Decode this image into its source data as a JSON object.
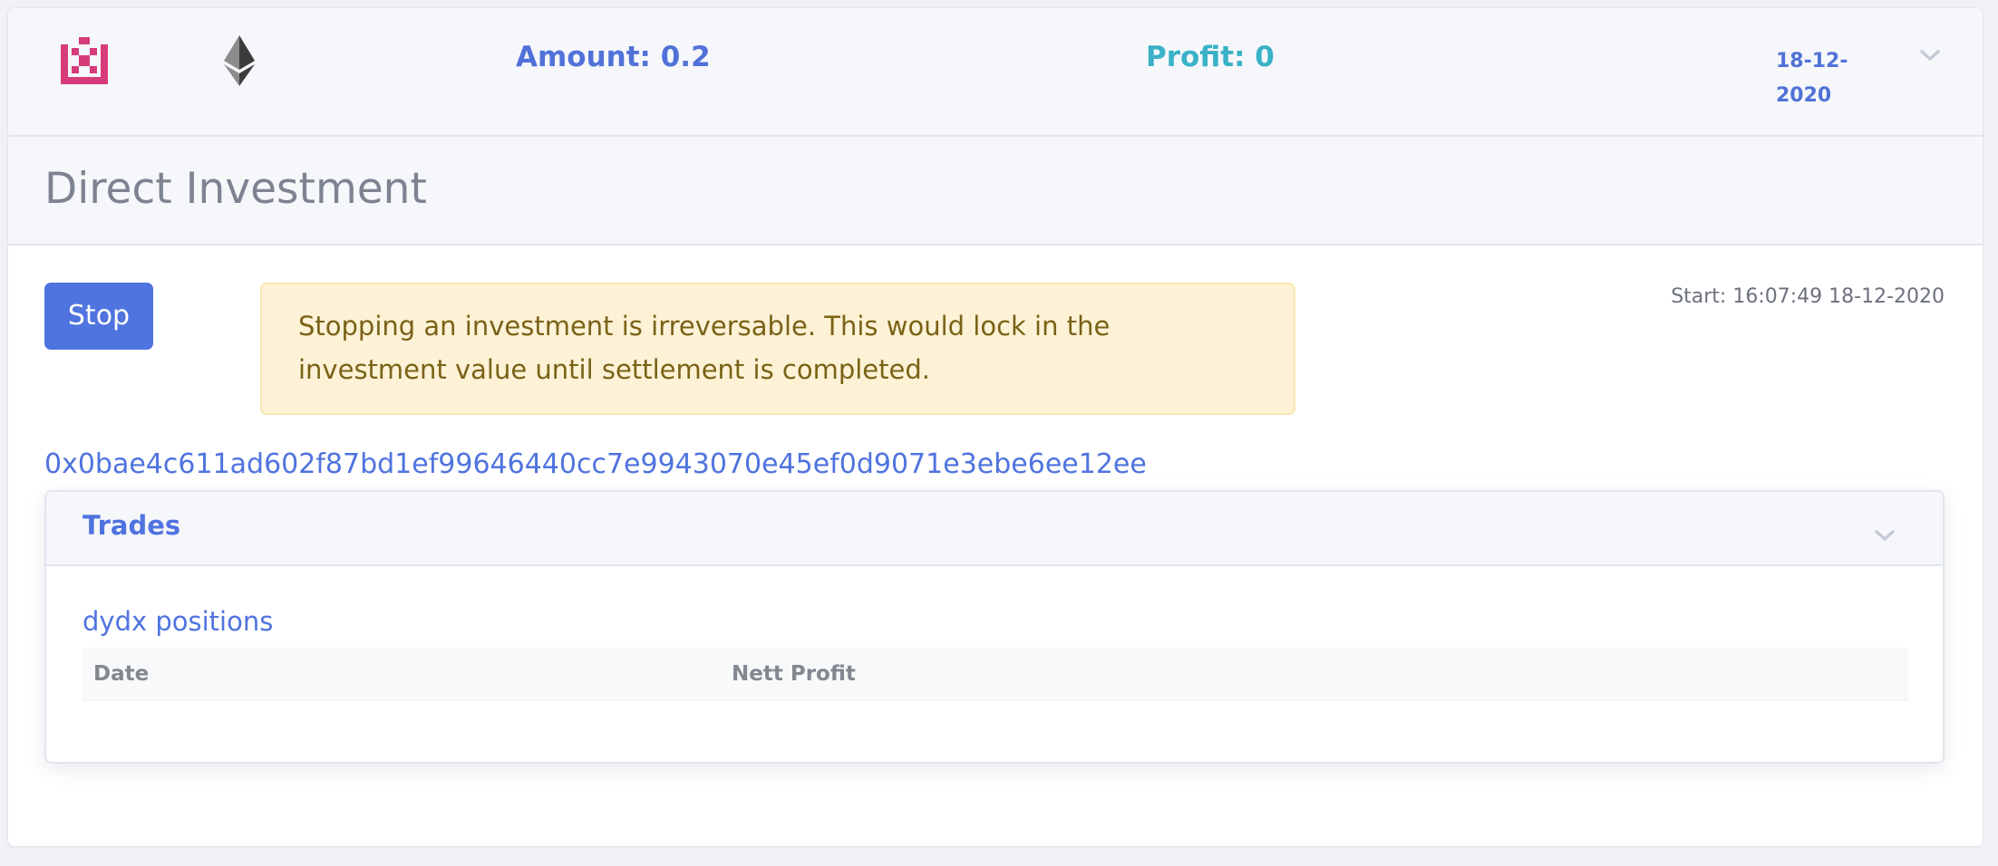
{
  "header": {
    "logo_icon": "pixel-logo-icon",
    "logo_color": "#d63b7a",
    "currency_icon": "ethereum-icon",
    "amount_text": "Amount: 0.2",
    "profit_text": "Profit: 0",
    "date_text": "18-12-2020",
    "expand_icon": "chevron-down-icon"
  },
  "section": {
    "title": "Direct Investment"
  },
  "actions": {
    "stop_label": "Stop",
    "warning_text": "Stopping an investment is irreversable. This would lock in the investment value until settlement is completed.",
    "start_text": "Start: 16:07:49 18-12-2020"
  },
  "transaction": {
    "hash": "0x0bae4c611ad602f87bd1ef99646440cc7e9943070e45ef0d9071e3ebe6ee12ee"
  },
  "trades": {
    "title": "Trades",
    "expand_icon": "chevron-down-icon",
    "positions_title": "dydx positions",
    "columns": [
      "Date",
      "Nett Profit"
    ],
    "rows": []
  },
  "colors": {
    "accent": "#4f73df",
    "profit": "#39b1c6",
    "warning_bg": "#fdf2d6",
    "warning_text": "#7a6216"
  }
}
